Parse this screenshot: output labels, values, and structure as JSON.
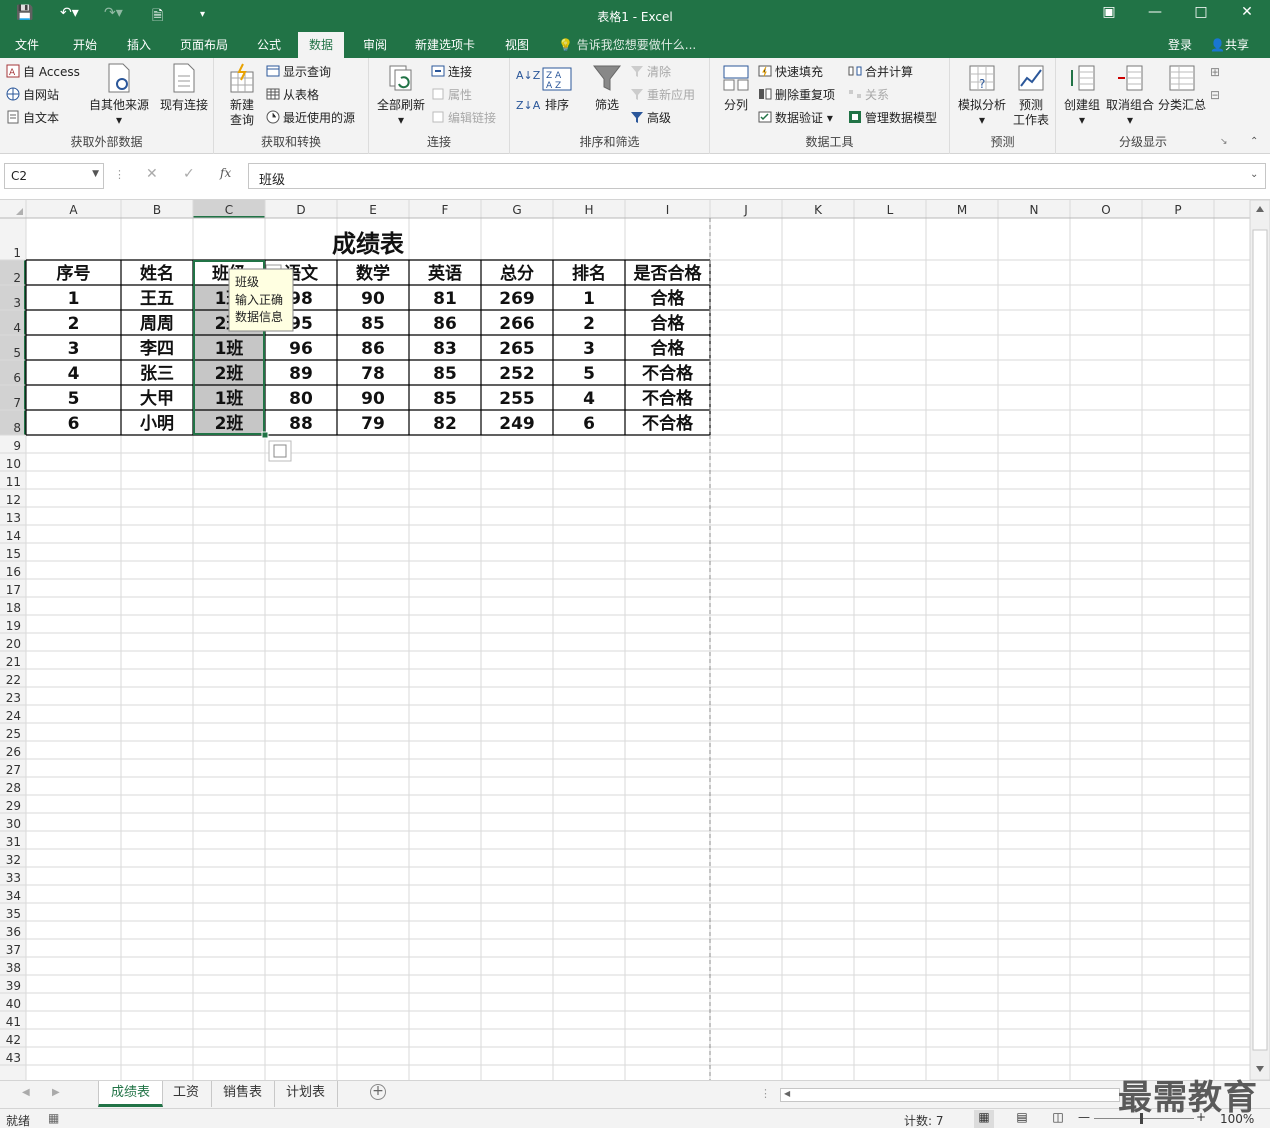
{
  "window": {
    "title": "表格1 - Excel"
  },
  "tabs": [
    "文件",
    "开始",
    "插入",
    "页面布局",
    "公式",
    "数据",
    "审阅",
    "新建选项卡",
    "视图"
  ],
  "active_tab": "数据",
  "tell_me": "告诉我您想要做什么...",
  "account": {
    "login": "登录",
    "share": "共享"
  },
  "ribbon": {
    "get_external": {
      "label": "获取外部数据",
      "access": "自 Access",
      "web": "自网站",
      "text": "自文本",
      "other": "自其他来源",
      "existing": "现有连接"
    },
    "get_transform": {
      "label": "获取和转换",
      "new_query": "新建\n查询",
      "show_queries": "显示查询",
      "from_table": "从表格",
      "recent": "最近使用的源"
    },
    "connections": {
      "label": "连接",
      "refresh_all": "全部刷新",
      "conn": "连接",
      "props": "属性",
      "edit_links": "编辑链接"
    },
    "sort_filter": {
      "label": "排序和筛选",
      "sort": "排序",
      "filter": "筛选",
      "clear": "清除",
      "reapply": "重新应用",
      "advanced": "高级"
    },
    "data_tools": {
      "label": "数据工具",
      "split": "分列",
      "flash_fill": "快速填充",
      "remove_dup": "删除重复项",
      "validation": "数据验证",
      "consolidate": "合并计算",
      "relations": "关系",
      "manage_model": "管理数据模型"
    },
    "forecast": {
      "label": "预测",
      "whatif": "模拟分析",
      "sheet": "预测\n工作表"
    },
    "outline": {
      "label": "分级显示",
      "group": "创建组",
      "ungroup": "取消组合",
      "subtotal": "分类汇总"
    }
  },
  "formula_bar": {
    "name_box": "C2",
    "fx": "fx",
    "content": "班级"
  },
  "columns": [
    "A",
    "B",
    "C",
    "D",
    "E",
    "F",
    "G",
    "H",
    "I",
    "J",
    "K",
    "L",
    "M",
    "N",
    "O",
    "P"
  ],
  "sheet": {
    "title": "成绩表",
    "headers": [
      "序号",
      "姓名",
      "班级",
      "语文",
      "数学",
      "英语",
      "总分",
      "排名",
      "是否合格"
    ],
    "rows": [
      [
        "1",
        "王五",
        "1班",
        "98",
        "90",
        "81",
        "269",
        "1",
        "合格"
      ],
      [
        "2",
        "周周",
        "2班",
        "95",
        "85",
        "86",
        "266",
        "2",
        "合格"
      ],
      [
        "3",
        "李四",
        "1班",
        "96",
        "86",
        "83",
        "265",
        "3",
        "合格"
      ],
      [
        "4",
        "张三",
        "2班",
        "89",
        "78",
        "85",
        "252",
        "5",
        "不合格"
      ],
      [
        "5",
        "大甲",
        "1班",
        "80",
        "90",
        "85",
        "255",
        "4",
        "不合格"
      ],
      [
        "6",
        "小明",
        "2班",
        "88",
        "79",
        "82",
        "249",
        "6",
        "不合格"
      ]
    ]
  },
  "tooltip": {
    "title": "班级",
    "line1": "输入正确",
    "line2": "数据信息"
  },
  "sheet_tabs": [
    "成绩表",
    "工资",
    "销售表",
    "计划表"
  ],
  "active_sheet": "成绩表",
  "status": {
    "ready": "就绪",
    "count": "计数: 7",
    "zoom": "100%"
  },
  "watermark": "最需教育",
  "colors": {
    "excel_green": "#217346",
    "selection": "#c6c6c6"
  }
}
